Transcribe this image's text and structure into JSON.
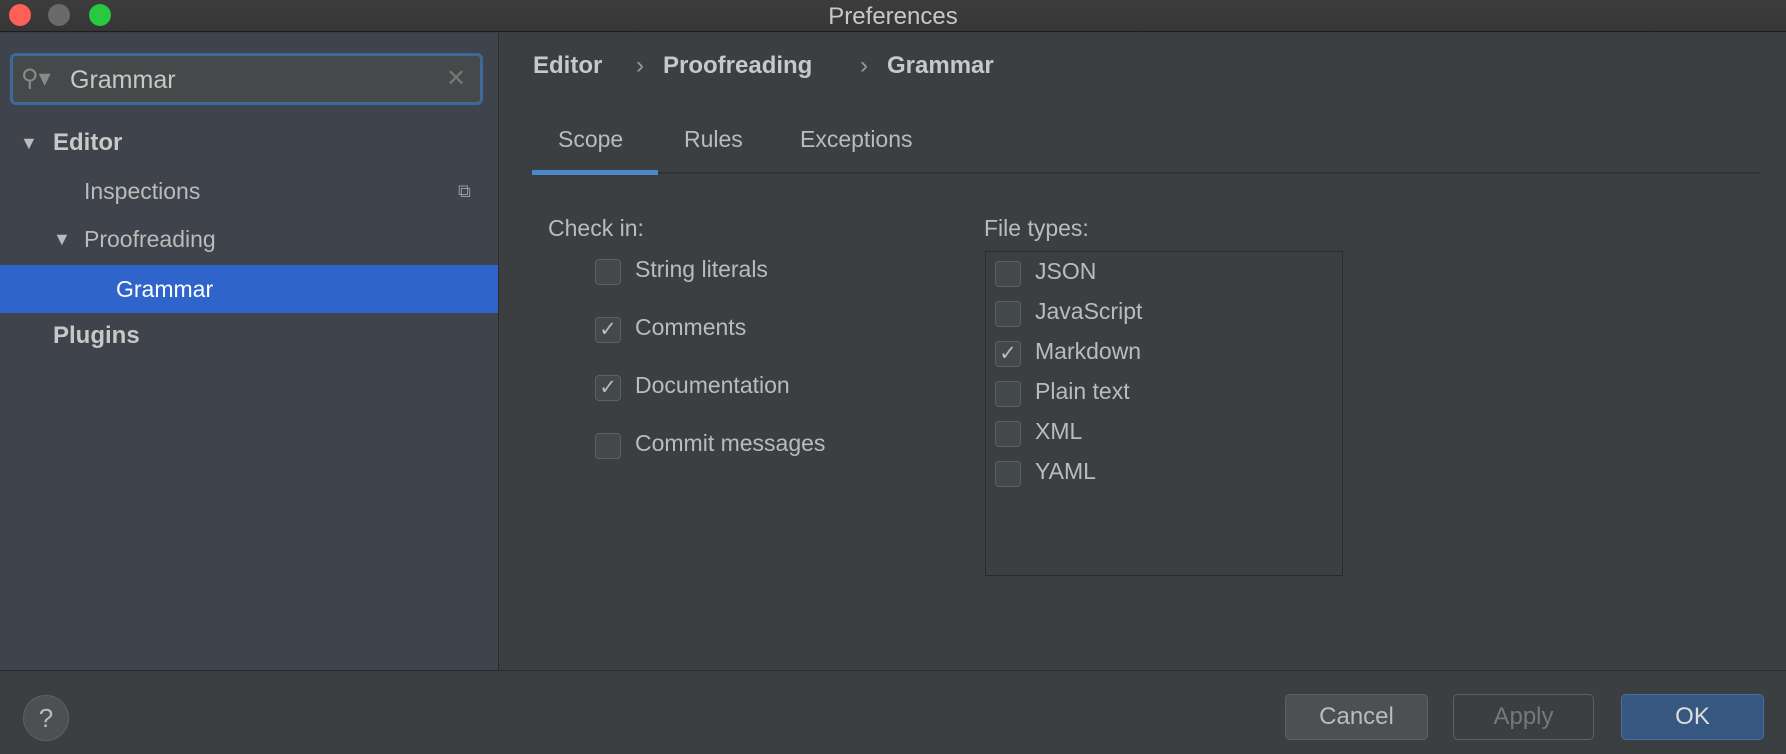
{
  "window": {
    "title": "Preferences"
  },
  "search": {
    "value": "Grammar"
  },
  "sidebar": {
    "items": [
      {
        "label": "Editor",
        "expanded": true
      },
      {
        "label": "Inspections"
      },
      {
        "label": "Proofreading",
        "expanded": true
      },
      {
        "label": "Grammar",
        "selected": true
      },
      {
        "label": "Plugins"
      }
    ]
  },
  "breadcrumb": [
    "Editor",
    "Proofreading",
    "Grammar"
  ],
  "tabs": [
    {
      "label": "Scope",
      "active": true
    },
    {
      "label": "Rules"
    },
    {
      "label": "Exceptions"
    }
  ],
  "check_in": {
    "label": "Check in:",
    "items": [
      {
        "label": "String literals",
        "checked": false
      },
      {
        "label": "Comments",
        "checked": true
      },
      {
        "label": "Documentation",
        "checked": true
      },
      {
        "label": "Commit messages",
        "checked": false
      }
    ]
  },
  "file_types": {
    "label": "File types:",
    "items": [
      {
        "label": "JSON",
        "checked": false
      },
      {
        "label": "JavaScript",
        "checked": false
      },
      {
        "label": "Markdown",
        "checked": true
      },
      {
        "label": "Plain text",
        "checked": false
      },
      {
        "label": "XML",
        "checked": false
      },
      {
        "label": "YAML",
        "checked": false
      }
    ]
  },
  "buttons": {
    "help": "?",
    "cancel": "Cancel",
    "apply": "Apply",
    "ok": "OK"
  },
  "colors": {
    "selection": "#2f65ca",
    "accent": "#4a88c7",
    "ok_button": "#365880"
  }
}
